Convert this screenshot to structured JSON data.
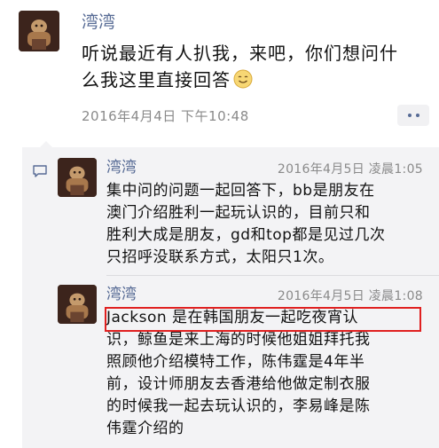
{
  "post": {
    "author": "湾湾",
    "text_line1": "听说最近有人扒我，来吧，你们想问什",
    "text_line2": "么我这里直接回答",
    "time": "2016年4月4日  下午10:48",
    "emoji_icon": "smile-emoji-icon"
  },
  "comments": [
    {
      "author": "湾湾",
      "time": "2016年4月5日  凌晨1:05",
      "lines": [
        "集中问的问题一起回答下，bb是朋友在",
        "澳门介绍胜利一起玩认识的，目前只和",
        "胜利大成是朋友，gd和top都是见过几次",
        "只招呼没联系方式，太阳只1次。"
      ]
    },
    {
      "author": "湾湾",
      "time": "2016年4月5日  凌晨1:08",
      "lines": [
        "Jackson 是在韩国朋友一起吃夜宵认",
        "识，鲸鱼是来上海的时候他姐姐拜托我",
        "照顾他介绍模特工作，陈伟霆是4年半",
        "前，设计师朋友去香港给他做定制衣服",
        "的时候我一起去玩认识的，李易峰是陈",
        "伟霆介绍的"
      ]
    }
  ],
  "colors": {
    "name": "#576b95",
    "highlight": "#e02020",
    "comment_bg": "#f3f3f5"
  }
}
